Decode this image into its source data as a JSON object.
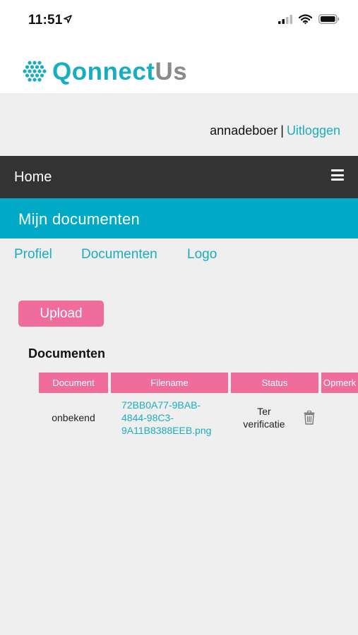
{
  "status_bar": {
    "time": "11:51"
  },
  "brand": {
    "logo_icon": "hexagon-cluster-icon",
    "name_part1": "Qonnect",
    "name_part2": "Us",
    "color_primary": "#19aebf",
    "color_secondary": "#8a8a8a"
  },
  "user": {
    "username": "annadeboer",
    "separator": "|",
    "logout_label": "Uitloggen"
  },
  "nav": {
    "home_label": "Home",
    "menu_icon": "hamburger-icon"
  },
  "page": {
    "title": "Mijn documenten"
  },
  "subnav": {
    "profile": "Profiel",
    "documents": "Documenten",
    "logo": "Logo"
  },
  "actions": {
    "upload_label": "Upload"
  },
  "documents": {
    "section_title": "Documenten",
    "columns": [
      "Document",
      "Filename",
      "Status",
      "Opmerk"
    ],
    "rows": [
      {
        "document": "onbekend",
        "filename_lines": [
          "72BB0A77-9BAB-",
          "4844-98C3-",
          "9A11B8388EEB.png"
        ],
        "status_lines": [
          "Ter",
          "verificatie"
        ],
        "action_icon": "trash-icon"
      }
    ]
  },
  "colors": {
    "accent_pink": "#f06c9b",
    "accent_teal": "#00a9c5",
    "nav_dark": "#333333",
    "background": "#efefef"
  }
}
